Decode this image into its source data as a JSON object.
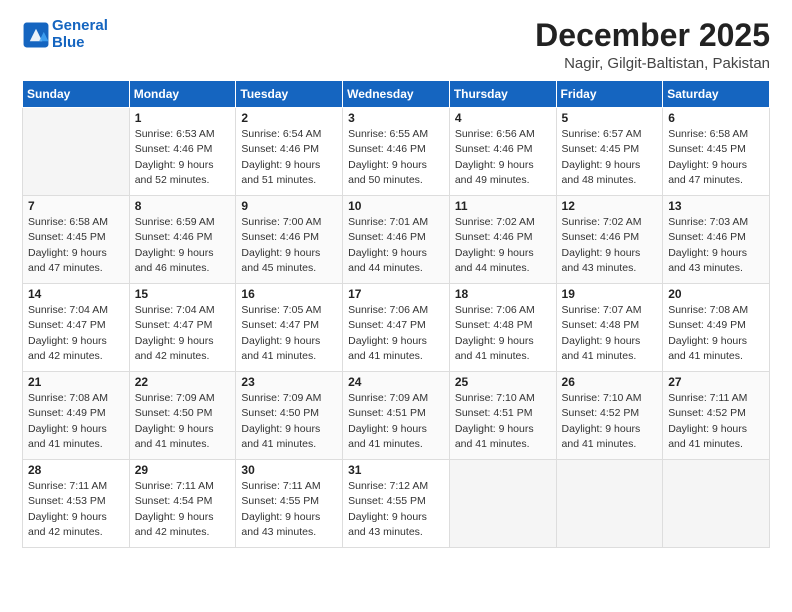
{
  "logo": {
    "line1": "General",
    "line2": "Blue"
  },
  "title": "December 2025",
  "subtitle": "Nagir, Gilgit-Baltistan, Pakistan",
  "days_header": [
    "Sunday",
    "Monday",
    "Tuesday",
    "Wednesday",
    "Thursday",
    "Friday",
    "Saturday"
  ],
  "weeks": [
    [
      {
        "day": "",
        "info": ""
      },
      {
        "day": "1",
        "info": "Sunrise: 6:53 AM\nSunset: 4:46 PM\nDaylight: 9 hours\nand 52 minutes."
      },
      {
        "day": "2",
        "info": "Sunrise: 6:54 AM\nSunset: 4:46 PM\nDaylight: 9 hours\nand 51 minutes."
      },
      {
        "day": "3",
        "info": "Sunrise: 6:55 AM\nSunset: 4:46 PM\nDaylight: 9 hours\nand 50 minutes."
      },
      {
        "day": "4",
        "info": "Sunrise: 6:56 AM\nSunset: 4:46 PM\nDaylight: 9 hours\nand 49 minutes."
      },
      {
        "day": "5",
        "info": "Sunrise: 6:57 AM\nSunset: 4:45 PM\nDaylight: 9 hours\nand 48 minutes."
      },
      {
        "day": "6",
        "info": "Sunrise: 6:58 AM\nSunset: 4:45 PM\nDaylight: 9 hours\nand 47 minutes."
      }
    ],
    [
      {
        "day": "7",
        "info": "Sunrise: 6:58 AM\nSunset: 4:45 PM\nDaylight: 9 hours\nand 47 minutes."
      },
      {
        "day": "8",
        "info": "Sunrise: 6:59 AM\nSunset: 4:46 PM\nDaylight: 9 hours\nand 46 minutes."
      },
      {
        "day": "9",
        "info": "Sunrise: 7:00 AM\nSunset: 4:46 PM\nDaylight: 9 hours\nand 45 minutes."
      },
      {
        "day": "10",
        "info": "Sunrise: 7:01 AM\nSunset: 4:46 PM\nDaylight: 9 hours\nand 44 minutes."
      },
      {
        "day": "11",
        "info": "Sunrise: 7:02 AM\nSunset: 4:46 PM\nDaylight: 9 hours\nand 44 minutes."
      },
      {
        "day": "12",
        "info": "Sunrise: 7:02 AM\nSunset: 4:46 PM\nDaylight: 9 hours\nand 43 minutes."
      },
      {
        "day": "13",
        "info": "Sunrise: 7:03 AM\nSunset: 4:46 PM\nDaylight: 9 hours\nand 43 minutes."
      }
    ],
    [
      {
        "day": "14",
        "info": "Sunrise: 7:04 AM\nSunset: 4:47 PM\nDaylight: 9 hours\nand 42 minutes."
      },
      {
        "day": "15",
        "info": "Sunrise: 7:04 AM\nSunset: 4:47 PM\nDaylight: 9 hours\nand 42 minutes."
      },
      {
        "day": "16",
        "info": "Sunrise: 7:05 AM\nSunset: 4:47 PM\nDaylight: 9 hours\nand 41 minutes."
      },
      {
        "day": "17",
        "info": "Sunrise: 7:06 AM\nSunset: 4:47 PM\nDaylight: 9 hours\nand 41 minutes."
      },
      {
        "day": "18",
        "info": "Sunrise: 7:06 AM\nSunset: 4:48 PM\nDaylight: 9 hours\nand 41 minutes."
      },
      {
        "day": "19",
        "info": "Sunrise: 7:07 AM\nSunset: 4:48 PM\nDaylight: 9 hours\nand 41 minutes."
      },
      {
        "day": "20",
        "info": "Sunrise: 7:08 AM\nSunset: 4:49 PM\nDaylight: 9 hours\nand 41 minutes."
      }
    ],
    [
      {
        "day": "21",
        "info": "Sunrise: 7:08 AM\nSunset: 4:49 PM\nDaylight: 9 hours\nand 41 minutes."
      },
      {
        "day": "22",
        "info": "Sunrise: 7:09 AM\nSunset: 4:50 PM\nDaylight: 9 hours\nand 41 minutes."
      },
      {
        "day": "23",
        "info": "Sunrise: 7:09 AM\nSunset: 4:50 PM\nDaylight: 9 hours\nand 41 minutes."
      },
      {
        "day": "24",
        "info": "Sunrise: 7:09 AM\nSunset: 4:51 PM\nDaylight: 9 hours\nand 41 minutes."
      },
      {
        "day": "25",
        "info": "Sunrise: 7:10 AM\nSunset: 4:51 PM\nDaylight: 9 hours\nand 41 minutes."
      },
      {
        "day": "26",
        "info": "Sunrise: 7:10 AM\nSunset: 4:52 PM\nDaylight: 9 hours\nand 41 minutes."
      },
      {
        "day": "27",
        "info": "Sunrise: 7:11 AM\nSunset: 4:52 PM\nDaylight: 9 hours\nand 41 minutes."
      }
    ],
    [
      {
        "day": "28",
        "info": "Sunrise: 7:11 AM\nSunset: 4:53 PM\nDaylight: 9 hours\nand 42 minutes."
      },
      {
        "day": "29",
        "info": "Sunrise: 7:11 AM\nSunset: 4:54 PM\nDaylight: 9 hours\nand 42 minutes."
      },
      {
        "day": "30",
        "info": "Sunrise: 7:11 AM\nSunset: 4:55 PM\nDaylight: 9 hours\nand 43 minutes."
      },
      {
        "day": "31",
        "info": "Sunrise: 7:12 AM\nSunset: 4:55 PM\nDaylight: 9 hours\nand 43 minutes."
      },
      {
        "day": "",
        "info": ""
      },
      {
        "day": "",
        "info": ""
      },
      {
        "day": "",
        "info": ""
      }
    ]
  ]
}
